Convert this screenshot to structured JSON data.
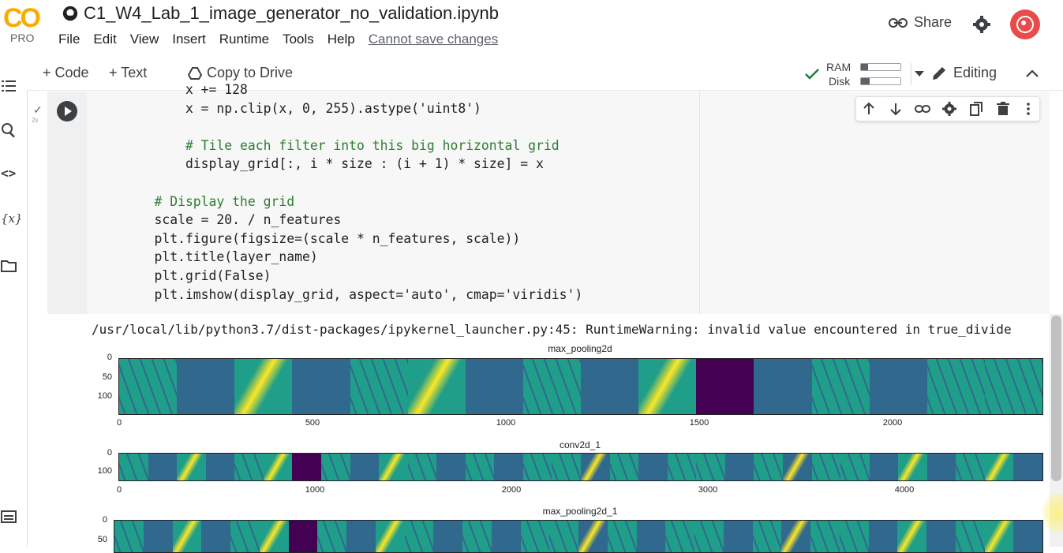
{
  "header": {
    "logo_text": "CO",
    "logo_badge": "PRO",
    "notebook_title": "C1_W4_Lab_1_image_generator_no_validation.ipynb",
    "menu": [
      "File",
      "Edit",
      "View",
      "Insert",
      "Runtime",
      "Tools",
      "Help"
    ],
    "cannot_save": "Cannot save changes",
    "share_label": "Share"
  },
  "toolbar": {
    "add_code": "+ Code",
    "add_text": "+ Text",
    "copy_to_drive": "Copy to Drive",
    "ram_label": "RAM",
    "disk_label": "Disk",
    "ram_usage": 0.18,
    "disk_usage": 0.22,
    "editing_label": "Editing"
  },
  "cell": {
    "exec_status": "✓",
    "exec_time": "2s",
    "lines": [
      {
        "text": "        x += 128"
      },
      {
        "text": "        x = np.clip(x, 0, 255).astype('uint8')"
      },
      {
        "text": ""
      },
      {
        "text": "        # Tile each filter into this big horizontal grid",
        "kind": "comment"
      },
      {
        "text": "        display_grid[:, i * size : (i + 1) * size] = x"
      },
      {
        "text": ""
      },
      {
        "text": "    # Display the grid",
        "kind": "comment"
      },
      {
        "text": "    scale = 20. / n_features"
      },
      {
        "text": "    plt.figure(figsize=(scale * n_features, scale))"
      },
      {
        "text": "    plt.title(layer_name)"
      },
      {
        "text": "    plt.grid(False)"
      },
      {
        "text": "    plt.imshow(display_grid, aspect='auto', cmap='viridis')"
      }
    ]
  },
  "output": {
    "warning": "/usr/local/lib/python3.7/dist-packages/ipykernel_launcher.py:45: RuntimeWarning: invalid value encountered in true_divide",
    "plots": [
      {
        "title": "max_pooling2d",
        "yticks": [
          "0",
          "50",
          "100"
        ],
        "xticks": [
          "0",
          "500",
          "1000",
          "1500",
          "2000"
        ],
        "dark_segment": [
          0.625,
          0.687
        ]
      },
      {
        "title": "conv2d_1",
        "yticks": [
          "0",
          "100"
        ],
        "xticks": [
          "0",
          "1000",
          "2000",
          "3000",
          "4000"
        ],
        "dark_segment": [
          0.188,
          0.219
        ]
      },
      {
        "title": "max_pooling2d_1",
        "yticks": [
          "0",
          "50"
        ],
        "xticks": [],
        "dark_segment": [
          0.188,
          0.219
        ]
      }
    ]
  },
  "colors": {
    "viridis_dark": "#440154",
    "viridis_teal": "#1f9e89",
    "viridis_blue": "#31688e",
    "viridis_yellow": "#fde725",
    "accent_check": "#188038"
  }
}
